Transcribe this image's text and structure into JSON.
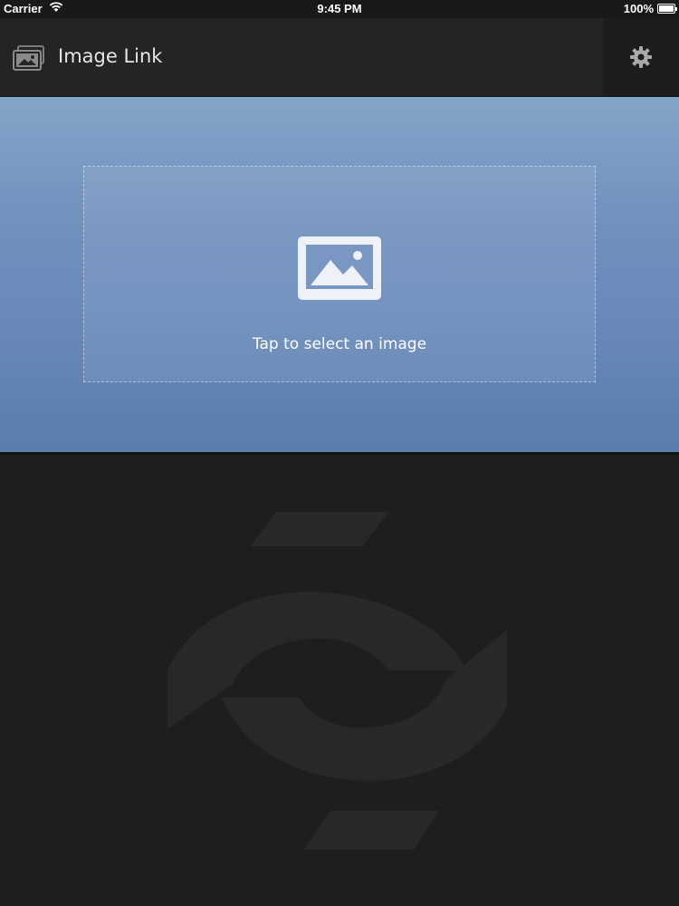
{
  "status_bar": {
    "carrier": "Carrier",
    "time": "9:45 PM",
    "battery": "100%"
  },
  "nav": {
    "title": "Image Link",
    "app_icon": "stacked-photos-icon",
    "settings_icon": "gear-icon"
  },
  "picker": {
    "prompt": "Tap to select an image",
    "icon": "photo-icon"
  },
  "background": {
    "logo": "eye-swirl-logo"
  },
  "colors": {
    "hero_top": "#84a4c8",
    "hero_bottom": "#5a7dae",
    "nav_bg": "#252425",
    "page_bg": "#1f1e1f"
  }
}
